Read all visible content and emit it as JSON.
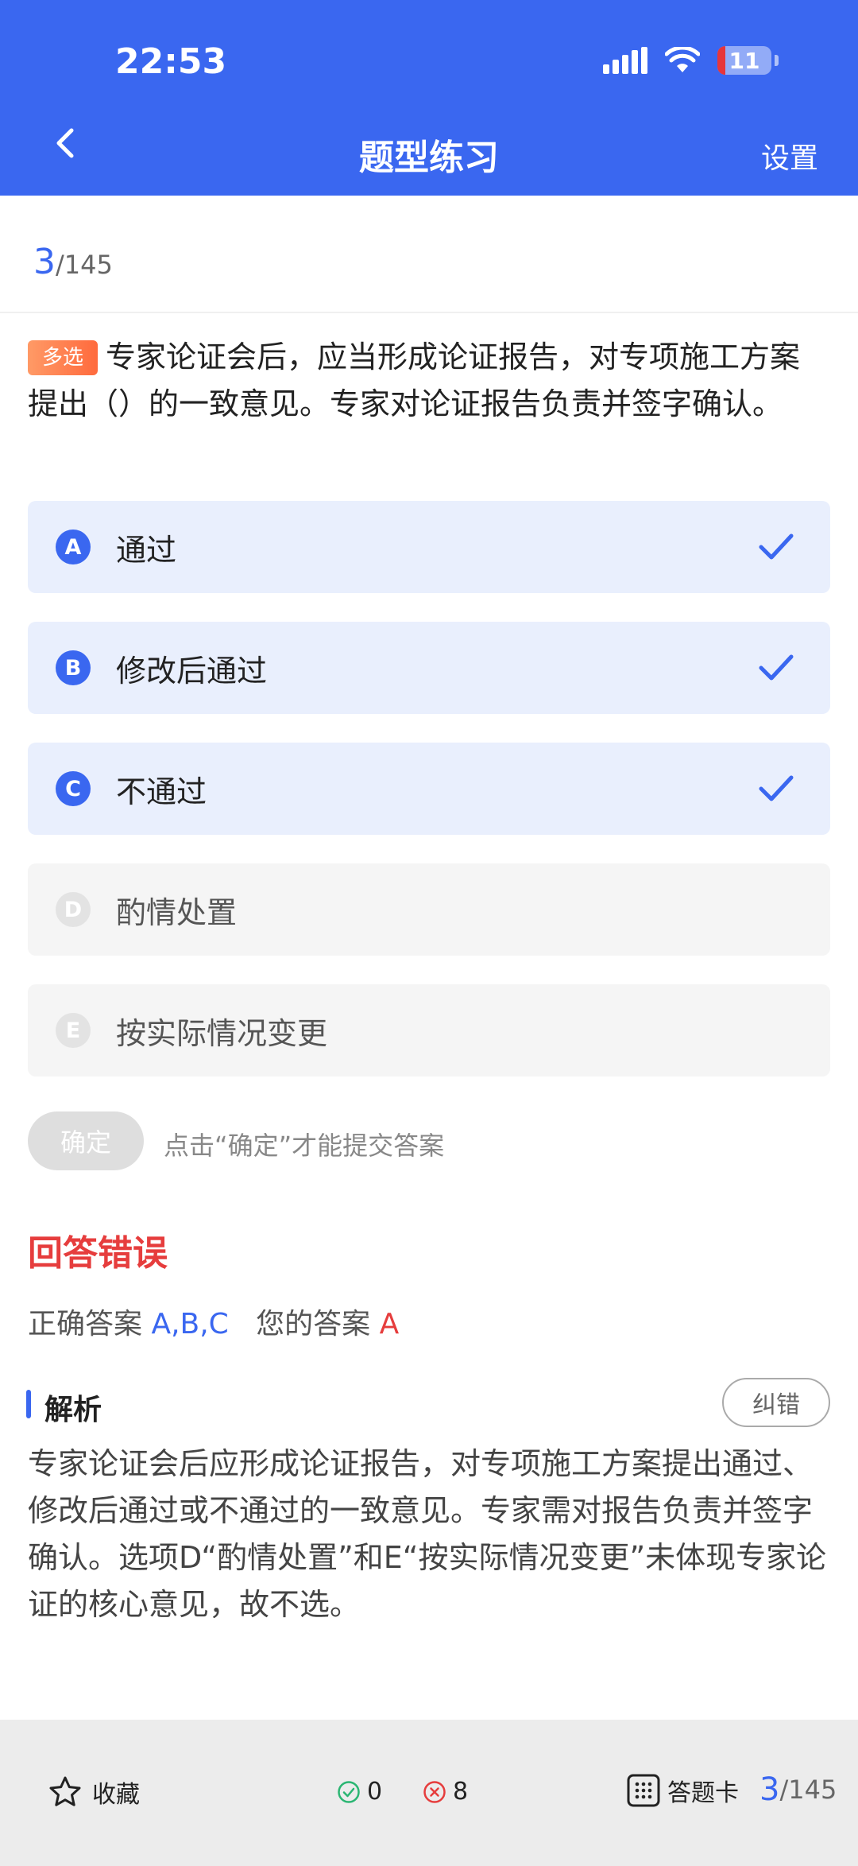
{
  "status_bar": {
    "time": "22:53",
    "battery": "11"
  },
  "header": {
    "title": "题型练习",
    "settings_label": "设置"
  },
  "progress": {
    "current": "3",
    "total": "/145"
  },
  "question": {
    "tag": "多选",
    "text": "专家论证会后，应当形成论证报告，对专项施工方案提出（）的一致意见。专家对论证报告负责并签字确认。"
  },
  "options": [
    {
      "letter": "A",
      "text": "通过",
      "selected": true
    },
    {
      "letter": "B",
      "text": "修改后通过",
      "selected": true
    },
    {
      "letter": "C",
      "text": "不通过",
      "selected": true
    },
    {
      "letter": "D",
      "text": "酌情处置",
      "selected": false
    },
    {
      "letter": "E",
      "text": "按实际情况变更",
      "selected": false
    }
  ],
  "confirm": {
    "label": "确定",
    "hint": "点击“确定”才能提交答案"
  },
  "result": {
    "title": "回答错误",
    "correct_label": "正确答案",
    "correct_value": "A,B,C",
    "yours_label": "您的答案",
    "yours_value": "A"
  },
  "analysis": {
    "title": "解析",
    "report_label": "纠错",
    "text": "专家论证会后应形成论证报告，对专项施工方案提出通过、修改后通过或不通过的一致意见。专家需对报告负责并签字确认。选项D“酌情处置”和E“按实际情况变更”未体现专家论证的核心意见，故不选。"
  },
  "bottom_bar": {
    "favorite_label": "收藏",
    "right_count": "0",
    "wrong_count": "8",
    "card_label": "答题卡",
    "page_current": "3",
    "page_total": "/145"
  },
  "colors": {
    "primary": "#3a67f0",
    "error": "#e63d3d",
    "tag": "#ff6a3d",
    "correct_icon": "#2bb673"
  }
}
